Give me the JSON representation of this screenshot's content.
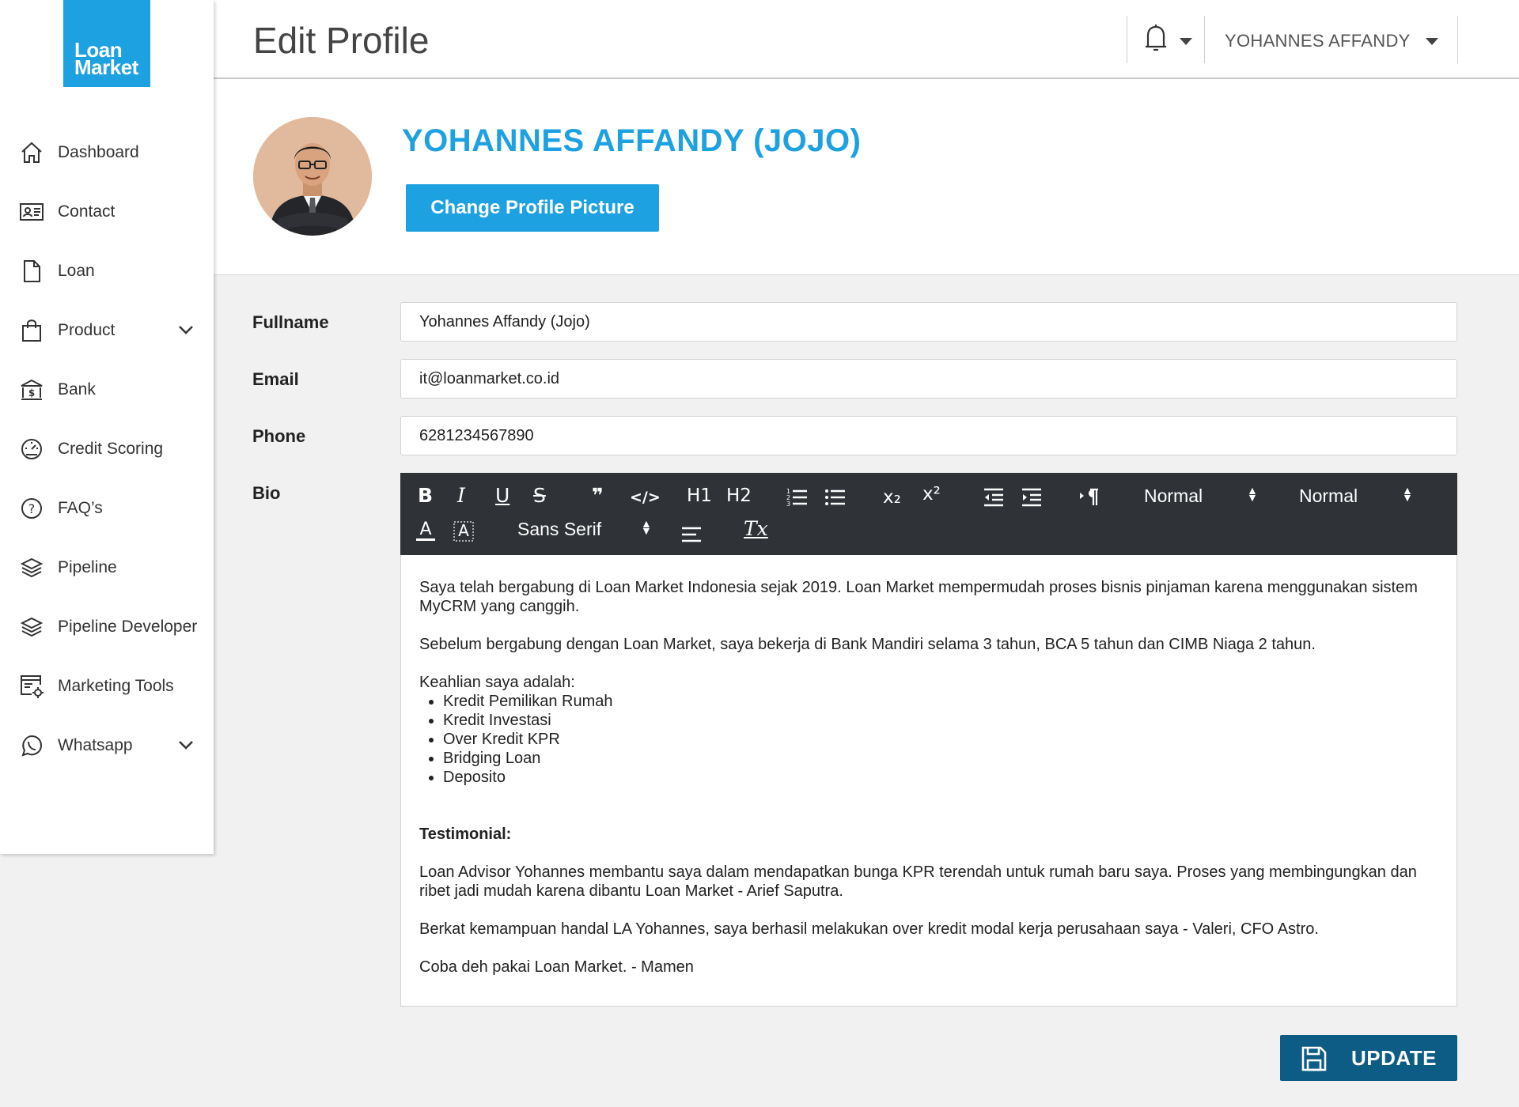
{
  "brand": {
    "logo_line1": "Loan",
    "logo_line2": "Market"
  },
  "sidebar": {
    "items": [
      {
        "label": "Dashboard",
        "icon": "home-icon"
      },
      {
        "label": "Contact",
        "icon": "contact-card-icon"
      },
      {
        "label": "Loan",
        "icon": "document-icon"
      },
      {
        "label": "Product",
        "icon": "shopping-bag-icon",
        "expandable": true
      },
      {
        "label": "Bank",
        "icon": "bank-icon"
      },
      {
        "label": "Credit Scoring",
        "icon": "gauge-icon"
      },
      {
        "label": "FAQ’s",
        "icon": "question-circle-icon"
      },
      {
        "label": "Pipeline",
        "icon": "layers-icon"
      },
      {
        "label": "Pipeline Developer",
        "icon": "layers-icon"
      },
      {
        "label": "Marketing Tools",
        "icon": "browser-gear-icon"
      },
      {
        "label": "Whatsapp",
        "icon": "whatsapp-icon",
        "expandable": true
      }
    ]
  },
  "header": {
    "title": "Edit Profile",
    "user_name": "YOHANNES AFFANDY"
  },
  "profile": {
    "display_name": "YOHANNES AFFANDY (JOJO)",
    "change_picture_label": "Change Profile Picture"
  },
  "form": {
    "fullname": {
      "label": "Fullname",
      "value": "Yohannes Affandy (Jojo)"
    },
    "email": {
      "label": "Email",
      "value": "it@loanmarket.co.id"
    },
    "phone": {
      "label": "Phone",
      "value": "6281234567890"
    },
    "bio": {
      "label": "Bio"
    }
  },
  "editor": {
    "toolbar": {
      "bold": "B",
      "italic": "I",
      "underline": "U",
      "strike": "S",
      "quote": "❞",
      "code": "</>",
      "h1": "H1",
      "h2": "H2",
      "sub": "x₂",
      "sup": "x²",
      "size_select": "Normal",
      "header_select": "Normal",
      "font_select": "Sans Serif",
      "clear": "Tx"
    },
    "content": {
      "p1": "Saya telah bergabung di Loan Market Indonesia sejak 2019. Loan Market mempermudah proses bisnis pinjaman karena menggunakan sistem MyCRM yang canggih.",
      "p2": "Sebelum bergabung dengan Loan Market, saya bekerja di Bank Mandiri selama 3 tahun, BCA 5 tahun dan CIMB Niaga 2 tahun.",
      "skills_intro": "Keahlian saya adalah:",
      "skills": [
        "Kredit Pemilikan Rumah",
        "Kredit Investasi",
        "Over Kredit KPR",
        "Bridging Loan",
        "Deposito"
      ],
      "testimonial_heading": "Testimonial:",
      "t1": "Loan Advisor Yohannes membantu saya dalam mendapatkan bunga KPR terendah untuk rumah baru saya. Proses yang membingungkan dan ribet jadi mudah karena dibantu Loan Market - Arief Saputra.",
      "t2": "Berkat kemampuan handal LA Yohannes, saya berhasil melakukan over kredit modal kerja perusahaan saya - Valeri, CFO Astro.",
      "t3": "Coba deh pakai Loan Market. - Mamen"
    }
  },
  "actions": {
    "update_label": "UPDATE"
  },
  "colors": {
    "brand": "#1da1e0",
    "update_button": "#0d5c85",
    "toolbar": "#2f3237",
    "background": "#f1f1f1"
  }
}
